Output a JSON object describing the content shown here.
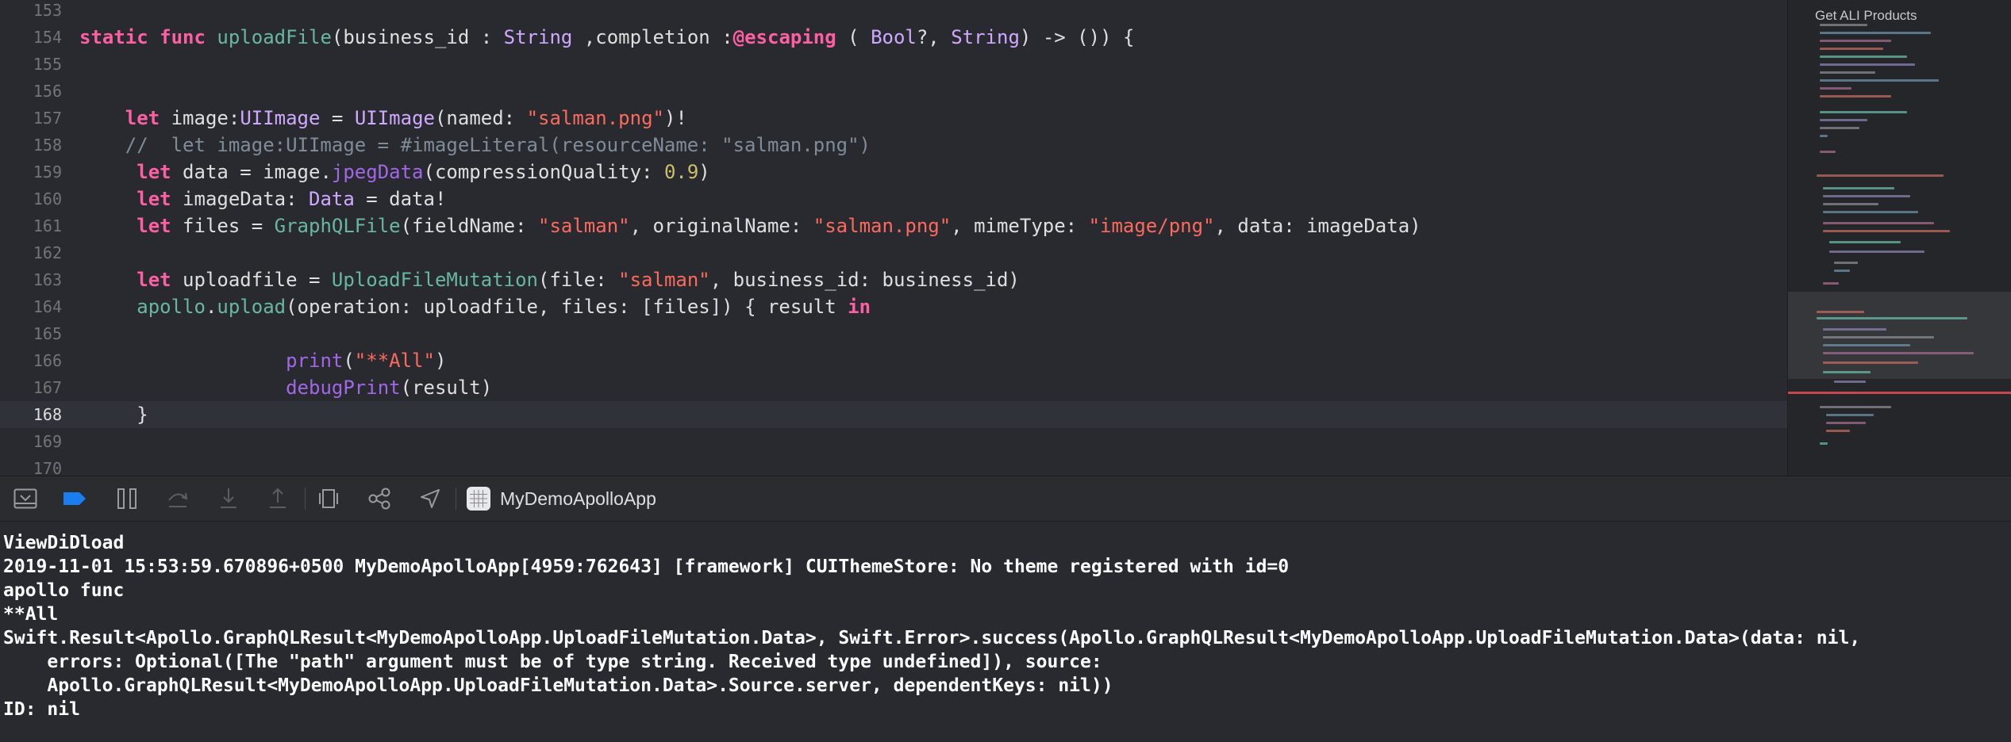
{
  "editor": {
    "lines": [
      {
        "num": "153",
        "tokens": []
      },
      {
        "num": "154",
        "tokens": [
          {
            "t": "static",
            "c": "kw"
          },
          {
            "t": " ",
            "c": "plain"
          },
          {
            "t": "func",
            "c": "kw"
          },
          {
            "t": " ",
            "c": "plain"
          },
          {
            "t": "uploadFile",
            "c": "fn"
          },
          {
            "t": "(business_id : ",
            "c": "plain"
          },
          {
            "t": "String",
            "c": "type"
          },
          {
            "t": " ,completion :",
            "c": "plain"
          },
          {
            "t": "@escaping",
            "c": "kw"
          },
          {
            "t": " ( ",
            "c": "plain"
          },
          {
            "t": "Bool",
            "c": "type"
          },
          {
            "t": "?, ",
            "c": "plain"
          },
          {
            "t": "String",
            "c": "type"
          },
          {
            "t": ") -> ()) {",
            "c": "plain"
          }
        ]
      },
      {
        "num": "155",
        "tokens": []
      },
      {
        "num": "156",
        "tokens": []
      },
      {
        "num": "157",
        "tokens": [
          {
            "t": "    ",
            "c": "plain"
          },
          {
            "t": "let",
            "c": "kw"
          },
          {
            "t": " image:",
            "c": "plain"
          },
          {
            "t": "UIImage",
            "c": "type"
          },
          {
            "t": " = ",
            "c": "plain"
          },
          {
            "t": "UIImage",
            "c": "type"
          },
          {
            "t": "(named: ",
            "c": "plain"
          },
          {
            "t": "\"salman.png\"",
            "c": "str"
          },
          {
            "t": ")!",
            "c": "plain"
          }
        ]
      },
      {
        "num": "158",
        "tokens": [
          {
            "t": "    //  let image:UIImage = #imageLiteral(resourceName: \"salman.png\")",
            "c": "cmt"
          }
        ]
      },
      {
        "num": "159",
        "tokens": [
          {
            "t": "     ",
            "c": "plain"
          },
          {
            "t": "let",
            "c": "kw"
          },
          {
            "t": " data = image.",
            "c": "plain"
          },
          {
            "t": "jpegData",
            "c": "ufn"
          },
          {
            "t": "(compressionQuality: ",
            "c": "plain"
          },
          {
            "t": "0.9",
            "c": "num"
          },
          {
            "t": ")",
            "c": "plain"
          }
        ]
      },
      {
        "num": "160",
        "tokens": [
          {
            "t": "     ",
            "c": "plain"
          },
          {
            "t": "let",
            "c": "kw"
          },
          {
            "t": " imageData: ",
            "c": "plain"
          },
          {
            "t": "Data",
            "c": "type"
          },
          {
            "t": " = data!",
            "c": "plain"
          }
        ]
      },
      {
        "num": "161",
        "tokens": [
          {
            "t": "     ",
            "c": "plain"
          },
          {
            "t": "let",
            "c": "kw"
          },
          {
            "t": " files = ",
            "c": "plain"
          },
          {
            "t": "GraphQLFile",
            "c": "fn"
          },
          {
            "t": "(fieldName: ",
            "c": "plain"
          },
          {
            "t": "\"salman\"",
            "c": "str"
          },
          {
            "t": ", originalName: ",
            "c": "plain"
          },
          {
            "t": "\"salman.png\"",
            "c": "str"
          },
          {
            "t": ", mimeType: ",
            "c": "plain"
          },
          {
            "t": "\"image/png\"",
            "c": "str"
          },
          {
            "t": ", data: imageData)",
            "c": "plain"
          }
        ]
      },
      {
        "num": "162",
        "tokens": []
      },
      {
        "num": "163",
        "tokens": [
          {
            "t": "     ",
            "c": "plain"
          },
          {
            "t": "let",
            "c": "kw"
          },
          {
            "t": " uploadfile = ",
            "c": "plain"
          },
          {
            "t": "UploadFileMutation",
            "c": "fn"
          },
          {
            "t": "(file: ",
            "c": "plain"
          },
          {
            "t": "\"salman\"",
            "c": "str"
          },
          {
            "t": ", business_id: business_id)",
            "c": "plain"
          }
        ]
      },
      {
        "num": "164",
        "tokens": [
          {
            "t": "     ",
            "c": "plain"
          },
          {
            "t": "apollo",
            "c": "fn"
          },
          {
            "t": ".",
            "c": "plain"
          },
          {
            "t": "upload",
            "c": "fn"
          },
          {
            "t": "(operation: uploadfile, files: [files]) { result ",
            "c": "plain"
          },
          {
            "t": "in",
            "c": "kw"
          }
        ]
      },
      {
        "num": "165",
        "tokens": []
      },
      {
        "num": "166",
        "tokens": [
          {
            "t": "                  ",
            "c": "plain"
          },
          {
            "t": "print",
            "c": "ufn"
          },
          {
            "t": "(",
            "c": "plain"
          },
          {
            "t": "\"**All\"",
            "c": "str"
          },
          {
            "t": ")",
            "c": "plain"
          }
        ]
      },
      {
        "num": "167",
        "tokens": [
          {
            "t": "                  ",
            "c": "plain"
          },
          {
            "t": "debugPrint",
            "c": "ufn"
          },
          {
            "t": "(result)",
            "c": "plain"
          }
        ]
      },
      {
        "num": "168",
        "current": true,
        "tokens": [
          {
            "t": "     }",
            "c": "plain"
          }
        ]
      },
      {
        "num": "169",
        "tokens": []
      },
      {
        "num": "170",
        "tokens": []
      }
    ]
  },
  "minimap": {
    "title": "Get ALI Products"
  },
  "debug_bar": {
    "app_name": "MyDemoApolloApp",
    "icons": [
      "hide-debug-area-icon",
      "breakpoints-toggle-icon",
      "pause-icon",
      "step-over-icon",
      "step-into-icon",
      "step-out-icon",
      "view-hierarchy-icon",
      "memory-graph-icon",
      "simulate-location-icon"
    ]
  },
  "console": {
    "lines": [
      "ViewDiDload",
      "2019-11-01 15:53:59.670896+0500 MyDemoApolloApp[4959:762643] [framework] CUIThemeStore: No theme registered with id=0",
      "apollo func",
      "**All",
      "Swift.Result<Apollo.GraphQLResult<MyDemoApolloApp.UploadFileMutation.Data>, Swift.Error>.success(Apollo.GraphQLResult<MyDemoApolloApp.UploadFileMutation.Data>(data: nil,",
      "    errors: Optional([The \"path\" argument must be of type string. Received type undefined]), source:",
      "    Apollo.GraphQLResult<MyDemoApolloApp.UploadFileMutation.Data>.Source.server, dependentKeys: nil))",
      "ID: nil"
    ]
  },
  "colors": {
    "background": "#292a30",
    "keyword": "#fc5fa3",
    "string": "#fc6a5d",
    "number": "#d0bf69",
    "type": "#d0a8ff",
    "function": "#67b7a4",
    "comment": "#7f8c98",
    "accent": "#1b7ef0"
  }
}
